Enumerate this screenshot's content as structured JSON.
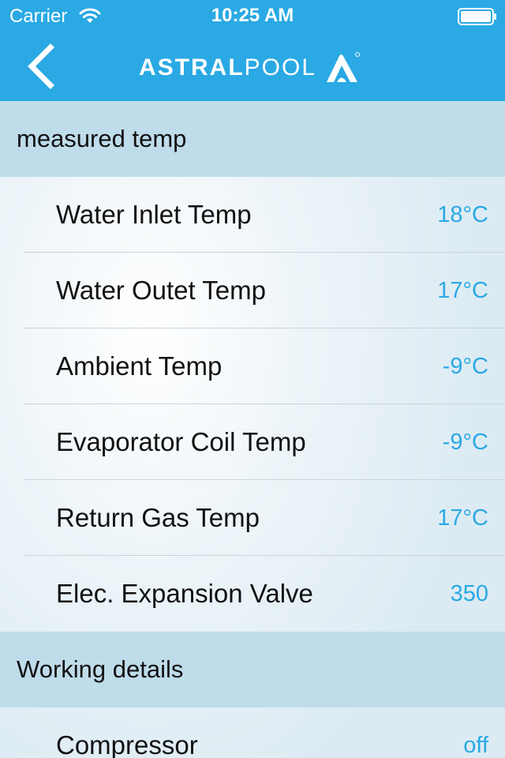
{
  "status_bar": {
    "carrier": "Carrier",
    "time": "10:25 AM"
  },
  "header": {
    "logo_bold": "ASTRAL",
    "logo_light": "POOL",
    "accent_color": "#2aa9e4",
    "back_icon": "chevron-left-icon"
  },
  "sections": [
    {
      "label": "measured temp",
      "rows": [
        {
          "label": "Water Inlet Temp",
          "value": "18°C"
        },
        {
          "label": "Water Outet Temp",
          "value": "17°C"
        },
        {
          "label": "Ambient Temp",
          "value": "-9°C"
        },
        {
          "label": "Evaporator Coil Temp",
          "value": "-9°C"
        },
        {
          "label": "Return Gas Temp",
          "value": "17°C"
        },
        {
          "label": "Elec. Expansion Valve",
          "value": "350"
        }
      ]
    },
    {
      "label": "Working details",
      "rows": [
        {
          "label": "Compressor",
          "value": "off"
        }
      ]
    }
  ]
}
